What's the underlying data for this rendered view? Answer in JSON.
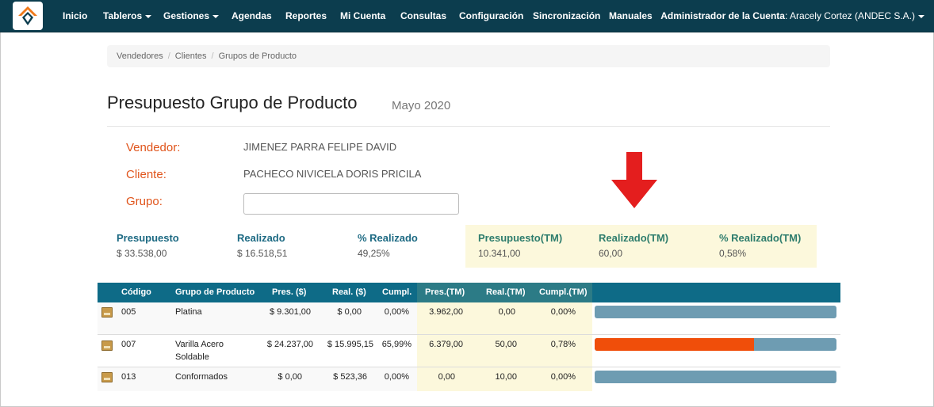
{
  "navbar": {
    "logo": "app-logo",
    "items": [
      {
        "label": "Inicio",
        "dropdown": false
      },
      {
        "label": "Tableros",
        "dropdown": true
      },
      {
        "label": "Gestiones",
        "dropdown": true
      },
      {
        "label": "Agendas",
        "dropdown": false
      },
      {
        "label": "Reportes",
        "dropdown": false
      },
      {
        "label": "Mi Cuenta",
        "dropdown": false
      },
      {
        "label": "Consultas",
        "dropdown": false
      },
      {
        "label": "Configuración",
        "dropdown": false
      },
      {
        "label": "Sincronización",
        "dropdown": false
      },
      {
        "label": "Manuales",
        "dropdown": false
      }
    ],
    "user_prefix": "Administrador de la Cuenta",
    "user_name": ": Aracely Cortez (ANDEC S.A.)"
  },
  "breadcrumb": [
    "Vendedores",
    "Clientes",
    "Grupos de Producto"
  ],
  "page": {
    "title": "Presupuesto Grupo de Producto",
    "subtitle": "Mayo 2020"
  },
  "info": {
    "vendedor_label": "Vendedor:",
    "vendedor_value": "JIMENEZ PARRA FELIPE DAVID",
    "cliente_label": "Cliente:",
    "cliente_value": "PACHECO NIVICELA DORIS PRICILA",
    "grupo_label": "Grupo:",
    "grupo_value": ""
  },
  "summary": [
    {
      "label": "Presupuesto",
      "value": "$ 33.538,00"
    },
    {
      "label": "Realizado",
      "value": "$ 16.518,51"
    },
    {
      "label": "% Realizado",
      "value": "49,25%"
    },
    {
      "label": "Presupuesto(TM)",
      "value": "10.341,00"
    },
    {
      "label": "Realizado(TM)",
      "value": "60,00"
    },
    {
      "label": "% Realizado(TM)",
      "value": "0,58%"
    }
  ],
  "table": {
    "headers": [
      "Código",
      "Grupo de Producto",
      "Pres. ($)",
      "Real. ($)",
      "Cumpl.",
      "Pres.(TM)",
      "Real.(TM)",
      "Cumpl.(TM)"
    ],
    "rows": [
      {
        "codigo": "005",
        "grupo": "Platina",
        "grupo2": "",
        "pres": "$ 9.301,00",
        "real": "$ 0,00",
        "cumpl": "0,00%",
        "pres_tm": "3.962,00",
        "real_tm": "0,00",
        "cumpl_tm": "0,00%",
        "progress": 0.0
      },
      {
        "codigo": "007",
        "grupo": "Varilla Acero",
        "grupo2": "Soldable",
        "pres": "$ 24.237,00",
        "real": "$ 15.995,15",
        "cumpl": "65,99%",
        "pres_tm": "6.379,00",
        "real_tm": "50,00",
        "cumpl_tm": "0,78%",
        "progress": 0.66
      },
      {
        "codigo": "013",
        "grupo": "Conformados",
        "grupo2": "",
        "pres": "$ 0,00",
        "real": "$ 523,36",
        "cumpl": "0,00%",
        "pres_tm": "0,00",
        "real_tm": "10,00",
        "cumpl_tm": "0,00%",
        "progress": 0.0
      }
    ]
  },
  "colors": {
    "navbar": "#0c3d4e",
    "accent_label": "#e0541b",
    "summary_label": "#1d6a83",
    "table_header": "#0e6b87",
    "tm_highlight": "#fcf8dc",
    "progress_fill": "#f04e0a",
    "progress_track": "#6e9cb2",
    "arrow": "#e41e1e"
  },
  "icons": {
    "arrow": "down-arrow-icon",
    "row": "box-icon"
  }
}
